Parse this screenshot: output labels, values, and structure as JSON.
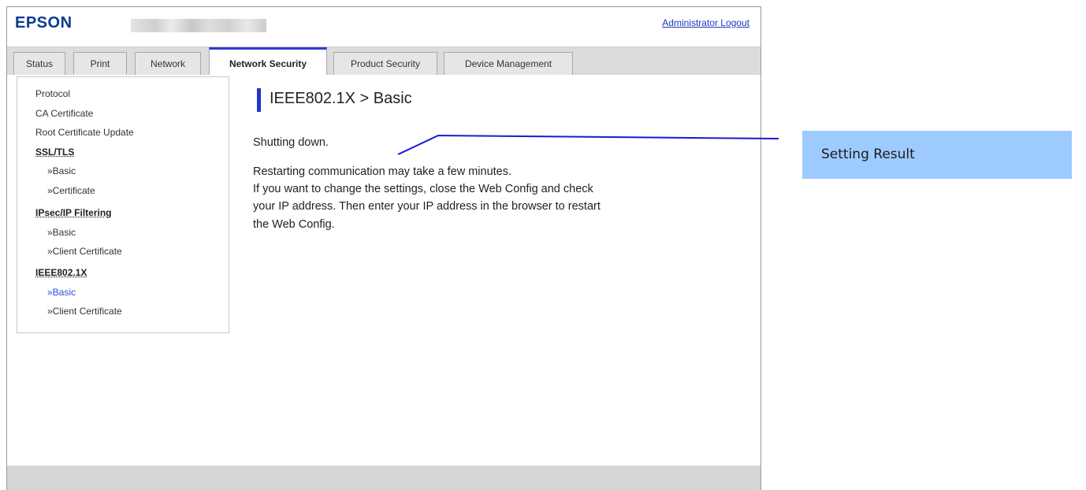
{
  "header": {
    "brand": "EPSON",
    "logout_label": "Administrator Logout"
  },
  "tabs": [
    {
      "label": "Status"
    },
    {
      "label": "Print"
    },
    {
      "label": "Network"
    },
    {
      "label": "Network Security",
      "active": true
    },
    {
      "label": "Product Security"
    },
    {
      "label": "Device Management"
    }
  ],
  "sidebar": {
    "items": [
      {
        "label": "Protocol"
      },
      {
        "label": "CA Certificate"
      },
      {
        "label": "Root Certificate Update"
      },
      {
        "label": "SSL/TLS"
      },
      {
        "label": "»Basic"
      },
      {
        "label": "»Certificate"
      },
      {
        "label": "IPsec/IP Filtering"
      },
      {
        "label": "»Basic"
      },
      {
        "label": "»Client Certificate"
      },
      {
        "label": "IEEE802.1X"
      },
      {
        "label": "»Basic",
        "current": true
      },
      {
        "label": "»Client Certificate"
      }
    ]
  },
  "main": {
    "title": "IEEE802.1X > Basic",
    "status": "Shutting down.",
    "lines": [
      "Restarting communication may take a few minutes.",
      "If you want to change the settings, close the Web Config and check",
      "your IP address. Then enter your IP address in the browser to restart",
      "the Web Config."
    ]
  },
  "callout": {
    "label": "Setting Result",
    "color": "#9ecbff",
    "line_color": "#1a1ad6"
  },
  "colors": {
    "accent": "#2036c8",
    "link": "#1a3bc1",
    "current_nav": "#2a4de0"
  }
}
